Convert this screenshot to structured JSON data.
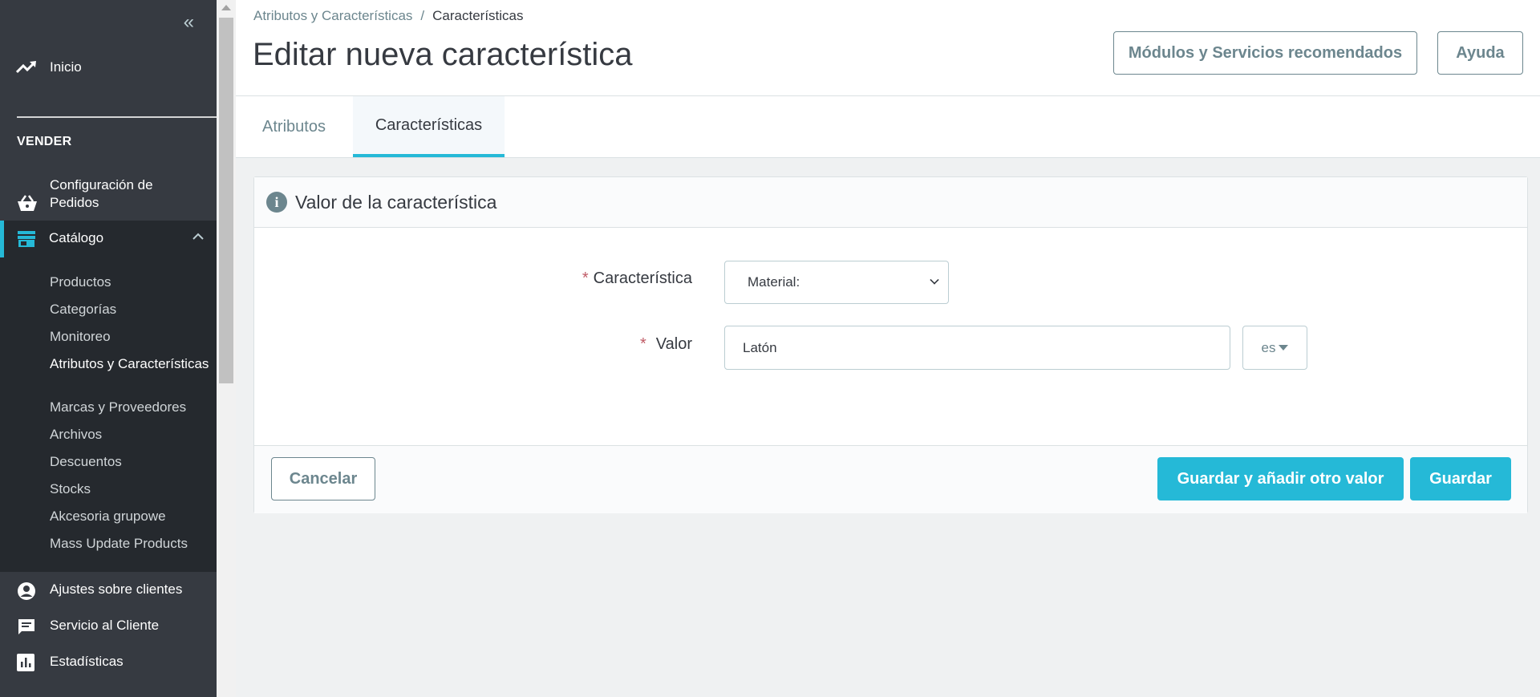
{
  "sidebar": {
    "home_label": "Inicio",
    "section_title": "VENDER",
    "orders_label": "Configuración de Pedidos",
    "catalog_label": "Catálogo",
    "catalog_items": [
      "Productos",
      "Categorías",
      "Monitoreo",
      "Atributos y Características",
      "Marcas y Proveedores",
      "Archivos",
      "Descuentos",
      "Stocks",
      "Akcesoria grupowe",
      "Mass Update Products"
    ],
    "customers_label": "Ajustes sobre clientes",
    "service_label": "Servicio al Cliente",
    "stats_label": "Estadísticas"
  },
  "header": {
    "breadcrumb_parent": "Atributos y Características",
    "breadcrumb_separator": "/",
    "breadcrumb_current": "Características",
    "title": "Editar nueva característica",
    "modules_button": "Módulos y Servicios recomendados",
    "help_button": "Ayuda"
  },
  "tabs": [
    {
      "label": "Atributos"
    },
    {
      "label": "Características"
    }
  ],
  "card": {
    "title": "Valor de la característica",
    "feature_label": "Característica",
    "feature_value": "Material:",
    "value_label": "Valor",
    "value_value": "Latón",
    "language": "es",
    "required_mark": "*"
  },
  "footer": {
    "cancel": "Cancelar",
    "save_add": "Guardar y añadir otro valor",
    "save": "Guardar"
  },
  "colors": {
    "accent": "#25b9d7",
    "sidebar_bg": "#363a41",
    "sidebar_active_bg": "#25292e"
  }
}
